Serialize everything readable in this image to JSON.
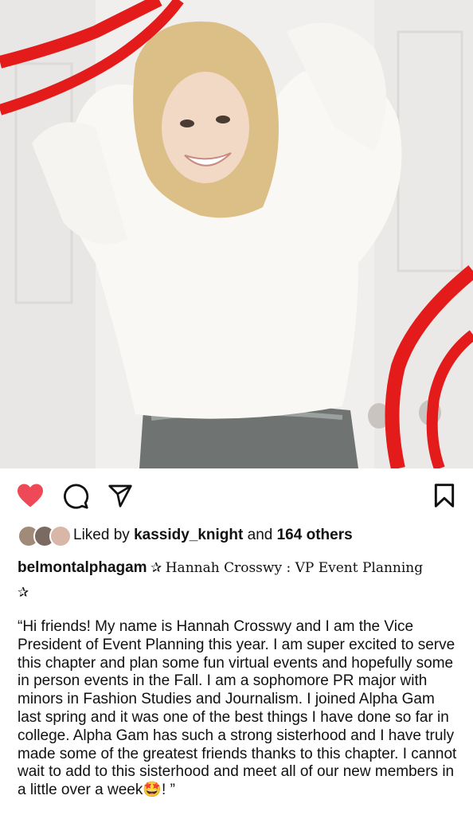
{
  "post": {
    "image": {
      "description_icon": "photo-icon"
    },
    "actions": {
      "like_icon": "heart-filled-icon",
      "comment_icon": "comment-icon",
      "share_icon": "send-icon",
      "save_icon": "bookmark-icon",
      "like_color": "#ed4956"
    },
    "likes": {
      "prefix": "Liked by",
      "user": "kassidy_knight",
      "middle": "and",
      "others": "164 others"
    },
    "caption": {
      "username": "belmontalphagam",
      "star": "✰",
      "title": "Hannah Crosswy : VP Event Planning",
      "star_end": "✰",
      "body": "“Hi friends! My name is Hannah Crosswy and I am the Vice President of Event Planning this year. I am super excited to serve this chapter and plan some fun virtual events and hopefully some in person events in the Fall. I am a sophomore PR major with minors in Fashion Studies and Journalism. I joined Alpha Gam last spring and it was one of the best things I have done so far in college. Alpha Gam has such a strong sisterhood and I have truly made some of the greatest friends thanks to this chapter. I cannot wait to add to this sisterhood and meet all of our new members in a little over a week🤩! ”"
    }
  }
}
